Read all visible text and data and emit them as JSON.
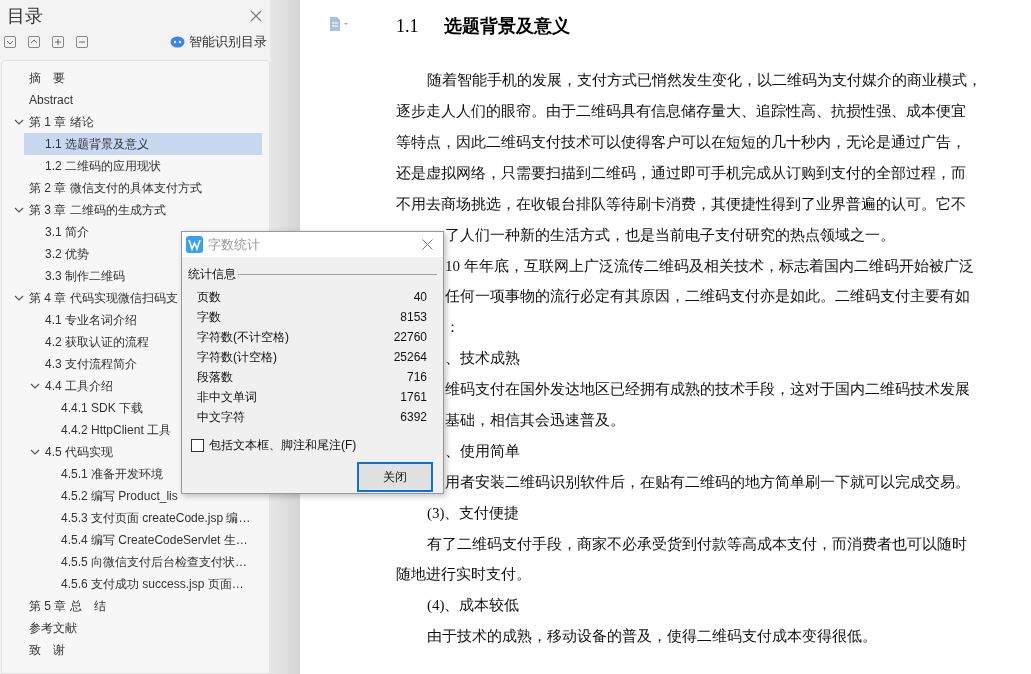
{
  "sidebar": {
    "title": "目录",
    "smart_button": "智能识别目录",
    "toc": [
      {
        "label": "摘　要",
        "selected": false
      },
      {
        "label": "Abstract",
        "selected": false
      },
      {
        "label": "第 1 章  绪论",
        "selected": false,
        "expanded": true,
        "children": [
          {
            "label": "1.1  选题背景及意义",
            "selected": true
          },
          {
            "label": "1.2  二维码的应用现状",
            "selected": false
          }
        ]
      },
      {
        "label": "第 2 章  微信支付的具体支付方式",
        "selected": false
      },
      {
        "label": "第 3 章  二维码的生成方式",
        "selected": false,
        "expanded": true,
        "children": [
          {
            "label": "3.1  简介",
            "selected": false
          },
          {
            "label": "3.2  优势",
            "selected": false
          },
          {
            "label": "3.3  制作二维码",
            "selected": false
          }
        ]
      },
      {
        "label": "第 4 章  代码实现微信扫码支",
        "selected": false,
        "expanded": true,
        "children": [
          {
            "label": "4.1  专业名词介绍",
            "selected": false
          },
          {
            "label": "4.2  获取认证的流程",
            "selected": false
          },
          {
            "label": "4.3  支付流程简介",
            "selected": false
          },
          {
            "label": "4.4  工具介绍",
            "selected": false,
            "expanded": true,
            "children": [
              {
                "label": "4.4.1  SDK 下载",
                "selected": false
              },
              {
                "label": "4.4.2  HttpClient 工具",
                "selected": false
              }
            ]
          },
          {
            "label": "4.5  代码实现",
            "selected": false,
            "expanded": true,
            "children": [
              {
                "label": "4.5.1  准备开发环境",
                "selected": false
              },
              {
                "label": "4.5.2  编写 Product_lis",
                "selected": false
              },
              {
                "label": "4.5.3  支付页面 createCode.jsp 编…",
                "selected": false
              },
              {
                "label": "4.5.4  编写 CreateCodeServlet 生…",
                "selected": false
              },
              {
                "label": "4.5.5  向微信支付后台检查支付状…",
                "selected": false
              },
              {
                "label": "4.5.6  支付成功 success.jsp 页面…",
                "selected": false
              }
            ]
          }
        ]
      },
      {
        "label": "第 5 章  总　结",
        "selected": false
      },
      {
        "label": "参考文献",
        "selected": false
      },
      {
        "label": "致　谢",
        "selected": false
      }
    ]
  },
  "document": {
    "heading_number": "1.1",
    "heading": "选题背景及意义",
    "lines": [
      {
        "kind": "first",
        "text": "随着智能手机的发展，支付方式已悄然发生变化，以二维码为支付媒介的商业模式，"
      },
      {
        "kind": "cont",
        "text": "逐步走人人们的眼帘。由于二维码具有信息储存量大、追踪性高、抗损性强、成本便宜"
      },
      {
        "kind": "cont",
        "text": "等特点，因此二维码支付技术可以使得客户可以在短短的几十秒内，无论是通过广告，"
      },
      {
        "kind": "cont",
        "text": "还是虚拟网络，只需要扫描到二维码，通过即可手机完成从订购到支付的全部过程，而"
      },
      {
        "kind": "cont",
        "text": "不用去商场挑选，在收银台排队等待刷卡消费，其便捷性得到了业界普遍的认可。它不"
      },
      {
        "kind": "clipped",
        "text": "了人们一种新的生活方式，也是当前电子支付研究的热点领域之一。"
      },
      {
        "kind": "clipped",
        "text": "10 年年底，互联网上广泛流传二维码及相关技术，标志着国内二维码开始被广泛"
      },
      {
        "kind": "clipped",
        "text": "任何一项事物的流行必定有其原因，二维码支付亦是如此。二维码支付主要有如"
      },
      {
        "kind": "clipped",
        "text": "："
      },
      {
        "kind": "clipped",
        "text": "、技术成熟"
      },
      {
        "kind": "clipped",
        "text": "维码支付在国外发达地区已经拥有成熟的技术手段，这对于国内二维码技术发展"
      },
      {
        "kind": "clipped",
        "text": "基础，相信其会迅速普及。"
      },
      {
        "kind": "clipped",
        "text": "、使用简单"
      },
      {
        "kind": "clipped",
        "text": "用者安装二维码识别软件后，在贴有二维码的地方简单刷一下就可以完成交易。"
      },
      {
        "kind": "first",
        "text": "(3)、支付便捷"
      },
      {
        "kind": "first",
        "text": "有了二维码支付手段，商家不必承受货到付款等高成本支付，而消费者也可以随时"
      },
      {
        "kind": "cont",
        "text": "随地进行实时支付。"
      },
      {
        "kind": "first",
        "text": "(4)、成本较低"
      },
      {
        "kind": "first",
        "text": "由于技术的成熟，移动设备的普及，使得二维码支付成本变得很低。"
      }
    ]
  },
  "dialog": {
    "title": "字数统计",
    "group": "统计信息",
    "stats": [
      {
        "label": "页数",
        "value": "40"
      },
      {
        "label": "字数",
        "value": "8153"
      },
      {
        "label": "字符数(不计空格)",
        "value": "22760"
      },
      {
        "label": "字符数(计空格)",
        "value": "25264"
      },
      {
        "label": "段落数",
        "value": "716"
      },
      {
        "label": "非中文单词",
        "value": "1761"
      },
      {
        "label": "中文字符",
        "value": "6392"
      }
    ],
    "checkbox": {
      "label": "包括文本框、脚注和尾注(F)",
      "checked": false
    },
    "button": "关闭"
  }
}
